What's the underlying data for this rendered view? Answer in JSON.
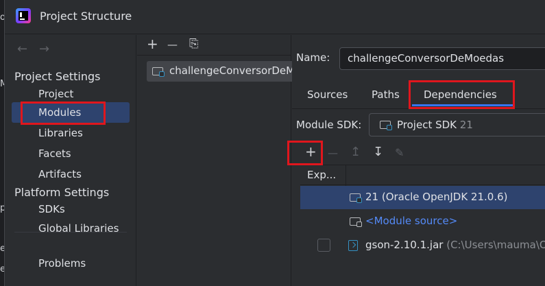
{
  "window": {
    "title": "Project Structure"
  },
  "background_fragments": [
    "ode",
    "Mo",
    "plo",
    "eda",
    "er"
  ],
  "nav": {
    "back": "←",
    "forward": "→",
    "project_settings": "Project Settings",
    "items_project": [
      "Project",
      "Modules",
      "Libraries",
      "Facets",
      "Artifacts"
    ],
    "platform_settings": "Platform Settings",
    "items_platform": [
      "SDKs",
      "Global Libraries"
    ],
    "problems": "Problems",
    "selected": "Modules"
  },
  "modules_pane": {
    "add": "+",
    "remove": "—",
    "copy": "⎘",
    "items": [
      "challengeConversorDeMoedas"
    ]
  },
  "module": {
    "name_label": "Name:",
    "name_value": "challengeConversorDeMoedas",
    "tabs": [
      "Sources",
      "Paths",
      "Dependencies"
    ],
    "active_tab": "Dependencies",
    "sdk_label": "Module SDK:",
    "sdk_value": "Project SDK",
    "sdk_version": "21"
  },
  "dependencies": {
    "toolbar": {
      "add": "+",
      "remove": "—",
      "up": "↥",
      "down": "↧",
      "edit": "✎"
    },
    "column_export": "Exp...",
    "rows": [
      {
        "label": "21 (Oracle OpenJDK 21.0.6)",
        "selected": true
      },
      {
        "label": "<Module source>",
        "link": true
      },
      {
        "label": "gson-2.10.1.jar",
        "path": "(C:\\Users\\mauma\\O",
        "checked": false
      }
    ]
  },
  "colors": {
    "accent": "#3574f0",
    "selection": "#2e436e",
    "highlight": "#e0161d",
    "link": "#548af7"
  }
}
